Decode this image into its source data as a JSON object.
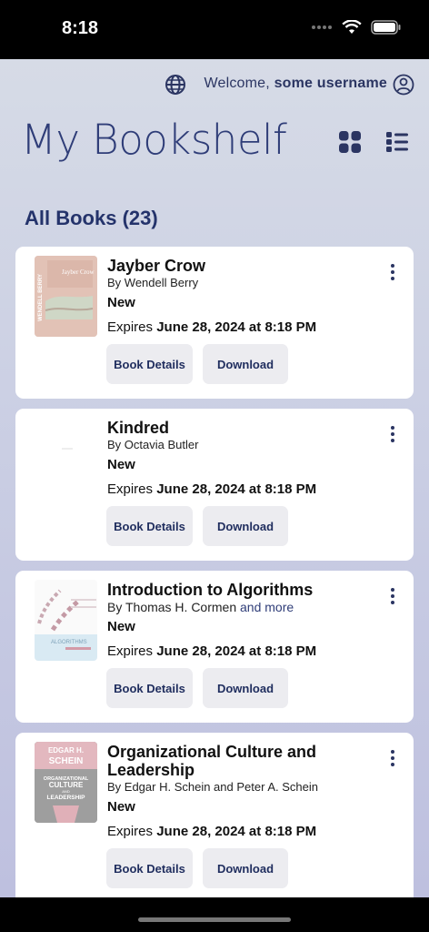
{
  "status_bar": {
    "time": "8:18"
  },
  "header": {
    "welcome_prefix": "Welcome,",
    "username": "some username"
  },
  "page": {
    "title": "My Bookshelf",
    "section_title": "All Books (23)"
  },
  "books": [
    {
      "title": "Jayber Crow",
      "author": "By Wendell Berry",
      "and_more": "",
      "status": "New",
      "expires_prefix": "Expires",
      "expires_date": "June 28, 2024 at 8:18 PM",
      "details_label": "Book Details",
      "download_label": "Download",
      "cover_color": "#d8b6a8",
      "cover_text": "WENDELL BERRY"
    },
    {
      "title": "Kindred",
      "author": "By Octavia Butler",
      "and_more": "",
      "status": "New",
      "expires_prefix": "Expires",
      "expires_date": "June 28, 2024 at 8:18 PM",
      "details_label": "Book Details",
      "download_label": "Download",
      "cover_color": "#ffffff"
    },
    {
      "title": "Introduction to Algorithms",
      "author": "By Thomas H. Cormen",
      "and_more": "and more",
      "status": "New",
      "expires_prefix": "Expires",
      "expires_date": "June 28, 2024 at 8:18 PM",
      "details_label": "Book Details",
      "download_label": "Download",
      "cover_color": "#d7e9f2",
      "cover_text": "ALGORITHMS"
    },
    {
      "title": "Organizational Culture and Leadership",
      "author": "By Edgar H. Schein and Peter A. Schein",
      "and_more": "",
      "status": "New",
      "expires_prefix": "Expires",
      "expires_date": "June 28, 2024 at 8:18 PM",
      "details_label": "Book Details",
      "download_label": "Download",
      "cover_color": "#a7a7a7",
      "cover_top_text": "EDGAR H. SCHEIN",
      "cover_mid_text": "ORGANIZATIONAL CULTURE AND LEADERSHIP"
    }
  ],
  "colors": {
    "accent": "#2f3d78",
    "button_bg": "#ececf0"
  }
}
